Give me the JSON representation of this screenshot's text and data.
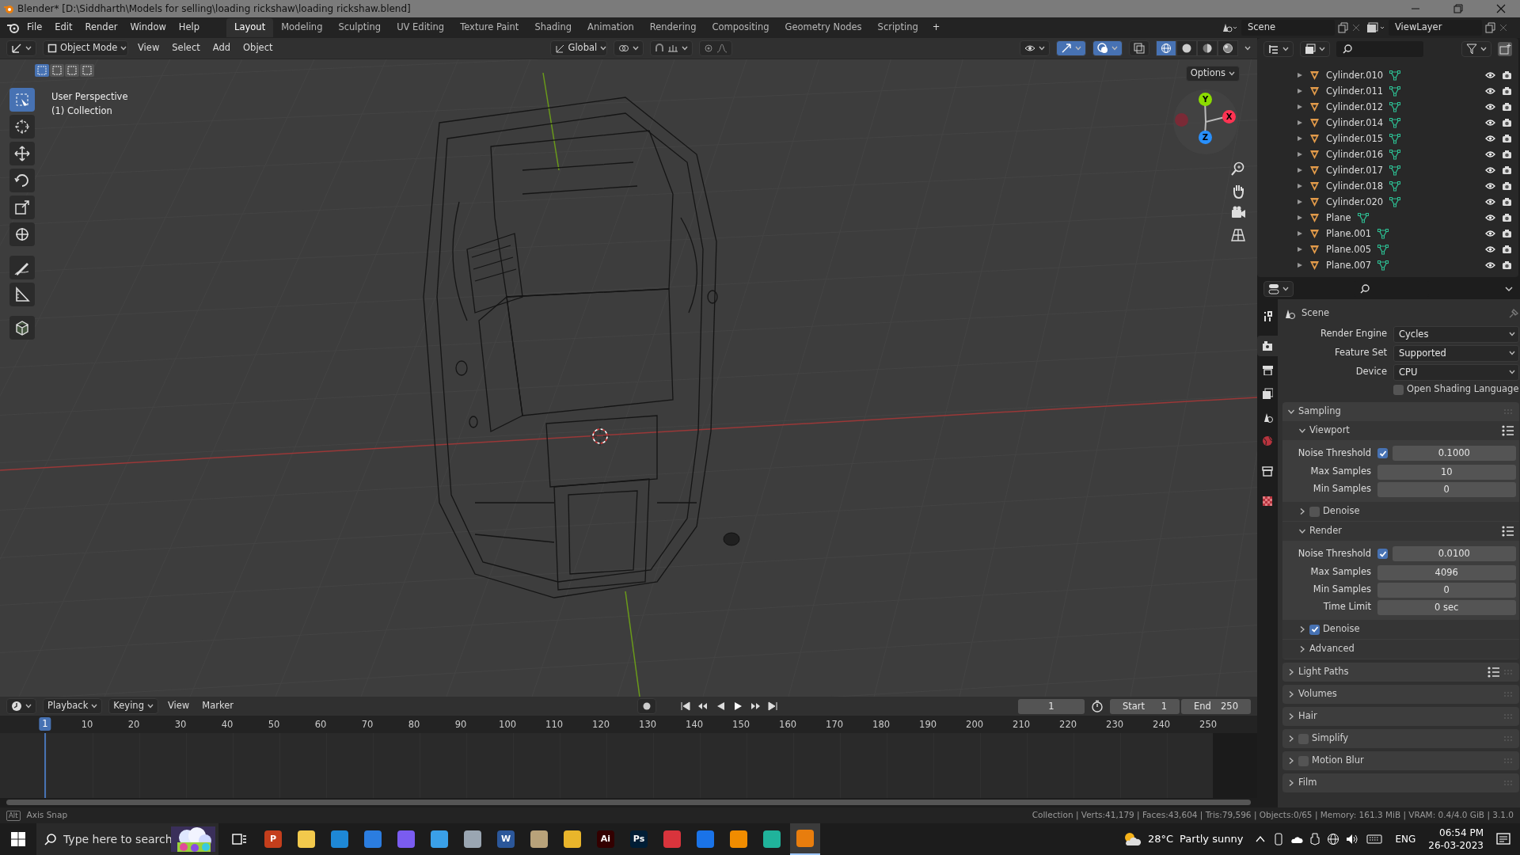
{
  "window": {
    "title": "Blender* [D:\\Siddharth\\Models for selling\\loading rickshaw\\loading rickshaw.blend]"
  },
  "menu": [
    "File",
    "Edit",
    "Render",
    "Window",
    "Help"
  ],
  "workspaces": [
    {
      "label": "Layout",
      "selected": true
    },
    {
      "label": "Modeling",
      "selected": false
    },
    {
      "label": "Sculpting",
      "selected": false
    },
    {
      "label": "UV Editing",
      "selected": false
    },
    {
      "label": "Texture Paint",
      "selected": false
    },
    {
      "label": "Shading",
      "selected": false
    },
    {
      "label": "Animation",
      "selected": false
    },
    {
      "label": "Rendering",
      "selected": false
    },
    {
      "label": "Compositing",
      "selected": false
    },
    {
      "label": "Geometry Nodes",
      "selected": false
    },
    {
      "label": "Scripting",
      "selected": false
    }
  ],
  "add_workspace": "+",
  "scene": "Scene",
  "view_layer": "ViewLayer",
  "viewport": {
    "mode": "Object Mode",
    "menus": [
      "View",
      "Select",
      "Add",
      "Object"
    ],
    "orientation": "Global",
    "options": "Options",
    "overlay_text": [
      "User Perspective",
      "(1) Collection"
    ],
    "tools": [
      {
        "kind": "select",
        "selected": true
      },
      {
        "kind": "cursor",
        "selected": false
      },
      {
        "kind": "move",
        "selected": false
      },
      {
        "kind": "rotate",
        "selected": false
      },
      {
        "kind": "scale",
        "selected": false
      },
      {
        "kind": "transform",
        "selected": false
      },
      {
        "kind": "annotate",
        "selected": false
      },
      {
        "kind": "measure",
        "selected": false
      },
      {
        "kind": "add_cube",
        "selected": false
      }
    ],
    "shading": [
      {
        "kind": "wireframe",
        "selected": true
      },
      {
        "kind": "solid",
        "selected": false
      },
      {
        "kind": "material",
        "selected": false
      },
      {
        "kind": "rendered",
        "selected": false
      }
    ],
    "gizmo": [
      {
        "label": "Y",
        "color": "#8bdc00"
      },
      {
        "label": "X",
        "color": "#ff3352"
      },
      {
        "label": "Z",
        "color": "#2890ff"
      }
    ]
  },
  "outliner": {
    "items": [
      "Cylinder.010",
      "Cylinder.011",
      "Cylinder.012",
      "Cylinder.014",
      "Cylinder.015",
      "Cylinder.016",
      "Cylinder.017",
      "Cylinder.018",
      "Cylinder.020",
      "Plane",
      "Plane.001",
      "Plane.005",
      "Plane.007"
    ]
  },
  "properties": {
    "tabs": [
      {
        "kind": "tool",
        "selected": false
      },
      {
        "kind": "render",
        "selected": true
      },
      {
        "kind": "output",
        "selected": false
      },
      {
        "kind": "view_layer",
        "selected": false
      },
      {
        "kind": "scene",
        "selected": false
      },
      {
        "kind": "world",
        "selected": false
      },
      {
        "kind": "collection",
        "selected": false
      },
      {
        "kind": "texture",
        "selected": false
      }
    ],
    "context": "Scene",
    "items": [
      {
        "kind": "dropdown",
        "label": "Render Engine",
        "value": "Cycles"
      },
      {
        "kind": "dropdown",
        "label": "Feature Set",
        "value": "Supported"
      },
      {
        "kind": "dropdown",
        "label": "Device",
        "value": "CPU"
      },
      {
        "kind": "checkbox",
        "label": "Open Shading Language",
        "checked": false
      },
      {
        "kind": "panel",
        "title": "Sampling",
        "expanded": true,
        "children": [
          {
            "kind": "panel",
            "title": "Viewport",
            "expanded": true,
            "presets": true,
            "children": [
              {
                "kind": "number",
                "label": "Noise Threshold",
                "checked": true,
                "value": "0.1000"
              },
              {
                "kind": "number",
                "label": "Max Samples",
                "value": "10"
              },
              {
                "kind": "number",
                "label": "Min Samples",
                "value": "0"
              }
            ]
          },
          {
            "kind": "panel",
            "title": "Denoise",
            "expanded": false,
            "checked": false
          },
          {
            "kind": "panel",
            "title": "Render",
            "expanded": true,
            "presets": true,
            "children": [
              {
                "kind": "number",
                "label": "Noise Threshold",
                "checked": true,
                "value": "0.0100"
              },
              {
                "kind": "number",
                "label": "Max Samples",
                "value": "4096"
              },
              {
                "kind": "number",
                "label": "Min Samples",
                "value": "0"
              },
              {
                "kind": "number",
                "label": "Time Limit",
                "value": "0 sec"
              }
            ]
          },
          {
            "kind": "panel",
            "title": "Denoise",
            "expanded": false,
            "checked": true
          },
          {
            "kind": "panel",
            "title": "Advanced",
            "expanded": false
          }
        ]
      },
      {
        "kind": "panel",
        "title": "Light Paths",
        "expanded": false,
        "presets": true
      },
      {
        "kind": "panel",
        "title": "Volumes",
        "expanded": false
      },
      {
        "kind": "panel",
        "title": "Hair",
        "expanded": false
      },
      {
        "kind": "panel",
        "title": "Simplify",
        "expanded": false,
        "checked": false
      },
      {
        "kind": "panel",
        "title": "Motion Blur",
        "expanded": false,
        "checked": false
      },
      {
        "kind": "panel",
        "title": "Film",
        "expanded": false
      }
    ]
  },
  "timeline": {
    "menus": [
      "Playback",
      "Keying",
      "View",
      "Marker"
    ],
    "frame": "1",
    "start_label": "Start",
    "start": "1",
    "end_label": "End",
    "end": "250",
    "playhead": "1",
    "ticks": [
      "10",
      "20",
      "30",
      "40",
      "50",
      "60",
      "70",
      "80",
      "90",
      "100",
      "110",
      "120",
      "130",
      "140",
      "150",
      "160",
      "170",
      "180",
      "190",
      "200",
      "210",
      "220",
      "230",
      "240",
      "250"
    ]
  },
  "status_bar": {
    "key": "Alt",
    "hint": "Axis Snap",
    "stats": "Collection | Verts:41,179 | Faces:43,604 | Tris:79,596 | Objects:0/65 | Memory: 161.3 MiB | VRAM: 0.4/4.0 GiB | 3.1.0"
  },
  "taskbar": {
    "search_placeholder": "Type here to search",
    "apps": [
      {
        "color": "#c43e1c",
        "glyph": "P",
        "selected": false
      },
      {
        "color": "#f2c94c",
        "selected": false
      },
      {
        "color": "#1e88d6",
        "selected": false
      },
      {
        "color": "#2b7de0",
        "selected": false
      },
      {
        "color": "#7a5cf0",
        "selected": false
      },
      {
        "color": "#3aa0e8",
        "selected": false
      },
      {
        "color": "#9aa6b2",
        "selected": false
      },
      {
        "color": "#2b579a",
        "glyph": "W",
        "selected": false
      },
      {
        "color": "#b8a27a",
        "selected": false
      },
      {
        "color": "#e9b52b",
        "selected": false
      },
      {
        "color": "#330000",
        "glyph": "Ai",
        "selected": false
      },
      {
        "color": "#001e36",
        "glyph": "Ps",
        "selected": false
      },
      {
        "color": "#d9343c",
        "selected": false
      },
      {
        "color": "#1a73e8",
        "selected": false
      },
      {
        "color": "#f08c00",
        "selected": false
      },
      {
        "color": "#20b39b",
        "selected": false
      },
      {
        "color": "#e87d0d",
        "selected": true
      }
    ],
    "temperature": "28°C",
    "weather": "Partly sunny",
    "language": "ENG",
    "time": "06:54 PM",
    "date": "26-03-2023"
  }
}
